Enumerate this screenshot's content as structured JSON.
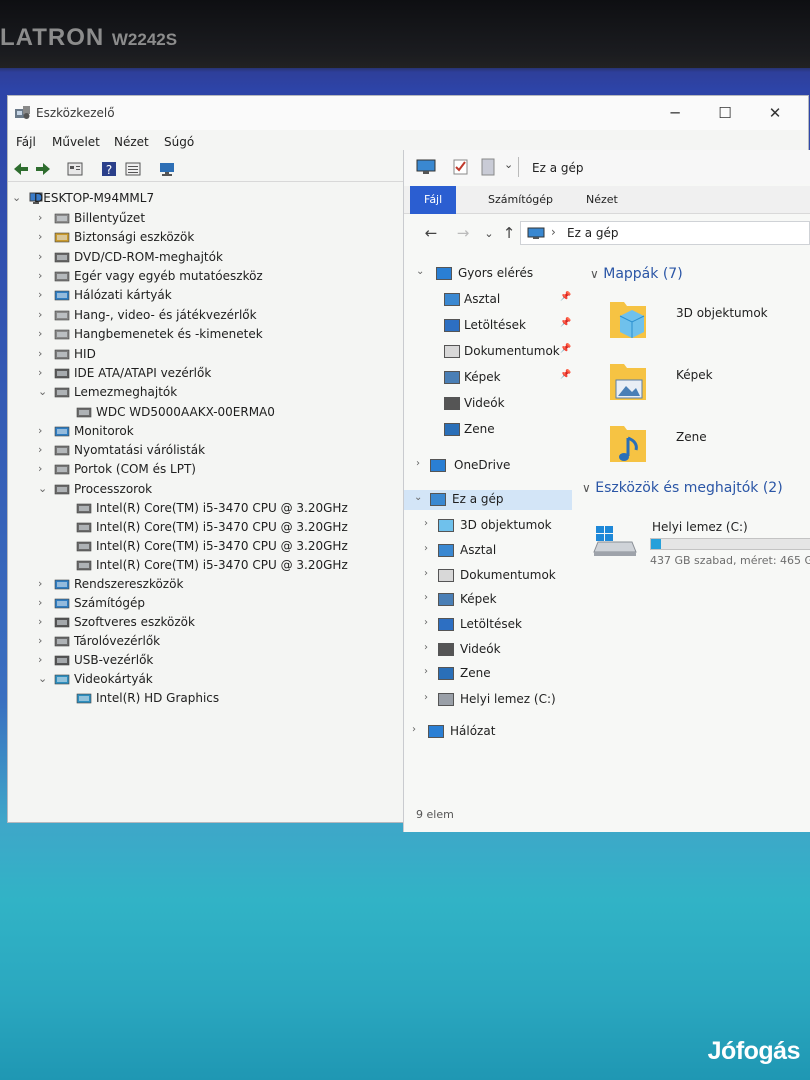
{
  "monitor": {
    "brand": "LATRON",
    "model": "W2242S"
  },
  "device_manager": {
    "title": "Eszközkezelő",
    "menu": [
      "Fájl",
      "Művelet",
      "Nézet",
      "Súgó"
    ],
    "tree": {
      "root": "DESKTOP-M94MML7",
      "items": [
        {
          "label": "Billentyűzet",
          "icon": "keyboard-icon"
        },
        {
          "label": "Biztonsági eszközök",
          "icon": "security-device-icon"
        },
        {
          "label": "DVD/CD-ROM-meghajtók",
          "icon": "dvd-drive-icon"
        },
        {
          "label": "Egér vagy egyéb mutatóeszköz",
          "icon": "mouse-icon"
        },
        {
          "label": "Hálózati kártyák",
          "icon": "network-adapter-icon"
        },
        {
          "label": "Hang-, video- és játékvezérlők",
          "icon": "sound-icon"
        },
        {
          "label": "Hangbemenetek és -kimenetek",
          "icon": "audio-io-icon"
        },
        {
          "label": "HID",
          "icon": "hid-icon"
        },
        {
          "label": "IDE ATA/ATAPI vezérlők",
          "icon": "ide-controller-icon"
        },
        {
          "label": "Lemezmeghajtók",
          "icon": "disk-drive-icon"
        },
        {
          "label": "WDC WD5000AAKX-00ERMA0",
          "icon": "disk-drive-icon"
        },
        {
          "label": "Monitorok",
          "icon": "monitor-icon"
        },
        {
          "label": "Nyomtatási várólisták",
          "icon": "printer-icon"
        },
        {
          "label": "Portok (COM és LPT)",
          "icon": "port-icon"
        },
        {
          "label": "Processzorok",
          "icon": "processor-icon"
        },
        {
          "label": "Intel(R) Core(TM) i5-3470 CPU @ 3.20GHz",
          "icon": "processor-icon"
        },
        {
          "label": "Intel(R) Core(TM) i5-3470 CPU @ 3.20GHz",
          "icon": "processor-icon"
        },
        {
          "label": "Intel(R) Core(TM) i5-3470 CPU @ 3.20GHz",
          "icon": "processor-icon"
        },
        {
          "label": "Intel(R) Core(TM) i5-3470 CPU @ 3.20GHz",
          "icon": "processor-icon"
        },
        {
          "label": "Rendszereszközök",
          "icon": "system-device-icon"
        },
        {
          "label": "Számítógép",
          "icon": "computer-icon"
        },
        {
          "label": "Szoftveres eszközök",
          "icon": "software-device-icon"
        },
        {
          "label": "Tárolóvezérlők",
          "icon": "storage-controller-icon"
        },
        {
          "label": "USB-vezérlők",
          "icon": "usb-icon"
        },
        {
          "label": "Videokártyák",
          "icon": "display-adapter-icon"
        },
        {
          "label": "Intel(R) HD Graphics",
          "icon": "display-adapter-icon"
        }
      ]
    }
  },
  "explorer": {
    "title": "Ez a gép",
    "ribbon_tabs": [
      "Fájl",
      "Számítógép",
      "Nézet"
    ],
    "address": "Ez a gép",
    "nav": {
      "quick_access": "Gyors elérés",
      "quick_items": [
        "Asztal",
        "Letöltések",
        "Dokumentumok",
        "Képek",
        "Videók",
        "Zene"
      ],
      "onedrive": "OneDrive",
      "this_pc": "Ez a gép",
      "pc_items": [
        "3D objektumok",
        "Asztal",
        "Dokumentumok",
        "Képek",
        "Letöltések",
        "Videók",
        "Zene",
        "Helyi lemez (C:)"
      ],
      "network": "Hálózat"
    },
    "folders_header": "Mappák (7)",
    "folders": [
      "3D objektumok",
      "Képek",
      "Zene"
    ],
    "drives_header": "Eszközök és meghajtók (2)",
    "drive": {
      "name": "Helyi lemez (C:)",
      "free_text": "437 GB szabad, méret: 465 G",
      "used_fraction": 0.06
    },
    "status": "9 elem"
  },
  "watermark": "Jófogás",
  "colors": {
    "accent": "#2b5ed1",
    "folder_yellow": "#f6c343",
    "selection": "#d3e5f7"
  }
}
